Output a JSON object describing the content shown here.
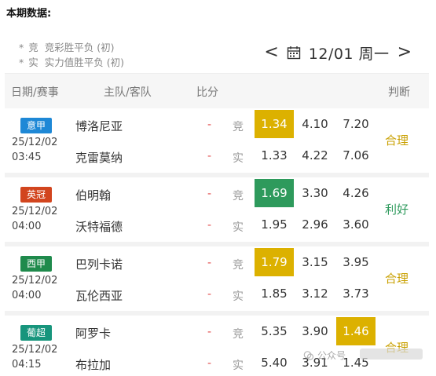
{
  "page_title": "本期数据:",
  "legend": [
    {
      "star": "*",
      "tag": "竞",
      "text": "竞彩胜平负 (初)"
    },
    {
      "star": "*",
      "tag": "实",
      "text": "实力值胜平负 (初)"
    }
  ],
  "date_nav": {
    "prev": "<",
    "date": "12/01 周一",
    "next": ">",
    "icon": "calendar-icon"
  },
  "headers": {
    "date_league": "日期/赛事",
    "teams": "主队/客队",
    "score": "比分",
    "verdict": "判断"
  },
  "matches": [
    {
      "league": "意甲",
      "league_color": "#1e88d6",
      "date": "25/12/02",
      "time": "03:45",
      "home": "博洛尼亚",
      "away": "克雷莫纳",
      "home_score": "-",
      "away_score": "-",
      "home_kind": "竞",
      "away_kind": "实",
      "home_odds": [
        "1.34",
        "4.10",
        "7.20"
      ],
      "away_odds": [
        "1.33",
        "4.22",
        "7.06"
      ],
      "verdict": "合理",
      "verdict_color": "#c9a000"
    },
    {
      "league": "英冠",
      "league_color": "#d2451e",
      "date": "25/12/02",
      "time": "04:00",
      "home": "伯明翰",
      "away": "沃特福德",
      "home_score": "-",
      "away_score": "-",
      "home_kind": "竞",
      "away_kind": "实",
      "home_odds": [
        "1.69",
        "3.30",
        "4.26"
      ],
      "away_odds": [
        "1.95",
        "2.96",
        "3.60"
      ],
      "verdict": "利好",
      "verdict_color": "#2e9a5c"
    },
    {
      "league": "西甲",
      "league_color": "#1f8a4c",
      "date": "25/12/02",
      "time": "04:00",
      "home": "巴列卡诺",
      "away": "瓦伦西亚",
      "home_score": "-",
      "away_score": "-",
      "home_kind": "竞",
      "away_kind": "实",
      "home_odds": [
        "1.79",
        "3.15",
        "3.95"
      ],
      "away_odds": [
        "1.85",
        "3.12",
        "3.73"
      ],
      "verdict": "合理",
      "verdict_color": "#c9a000"
    },
    {
      "league": "葡超",
      "league_color": "#17957c",
      "date": "25/12/02",
      "time": "04:15",
      "home": "阿罗卡",
      "away": "布拉加",
      "home_score": "-",
      "away_score": "-",
      "home_kind": "竞",
      "away_kind": "实",
      "home_odds": [
        "5.35",
        "3.90",
        "1.46"
      ],
      "away_odds": [
        "5.40",
        "3.91",
        "1.45"
      ],
      "verdict": "合理",
      "verdict_color": "#c9a000"
    }
  ],
  "highlights": [
    {
      "color": "yellow",
      "col": 0
    },
    {
      "color": "green",
      "col": 0
    },
    {
      "color": "yellow",
      "col": 0
    },
    {
      "color": "yellow",
      "col": 2
    }
  ],
  "watermark": "公众号"
}
